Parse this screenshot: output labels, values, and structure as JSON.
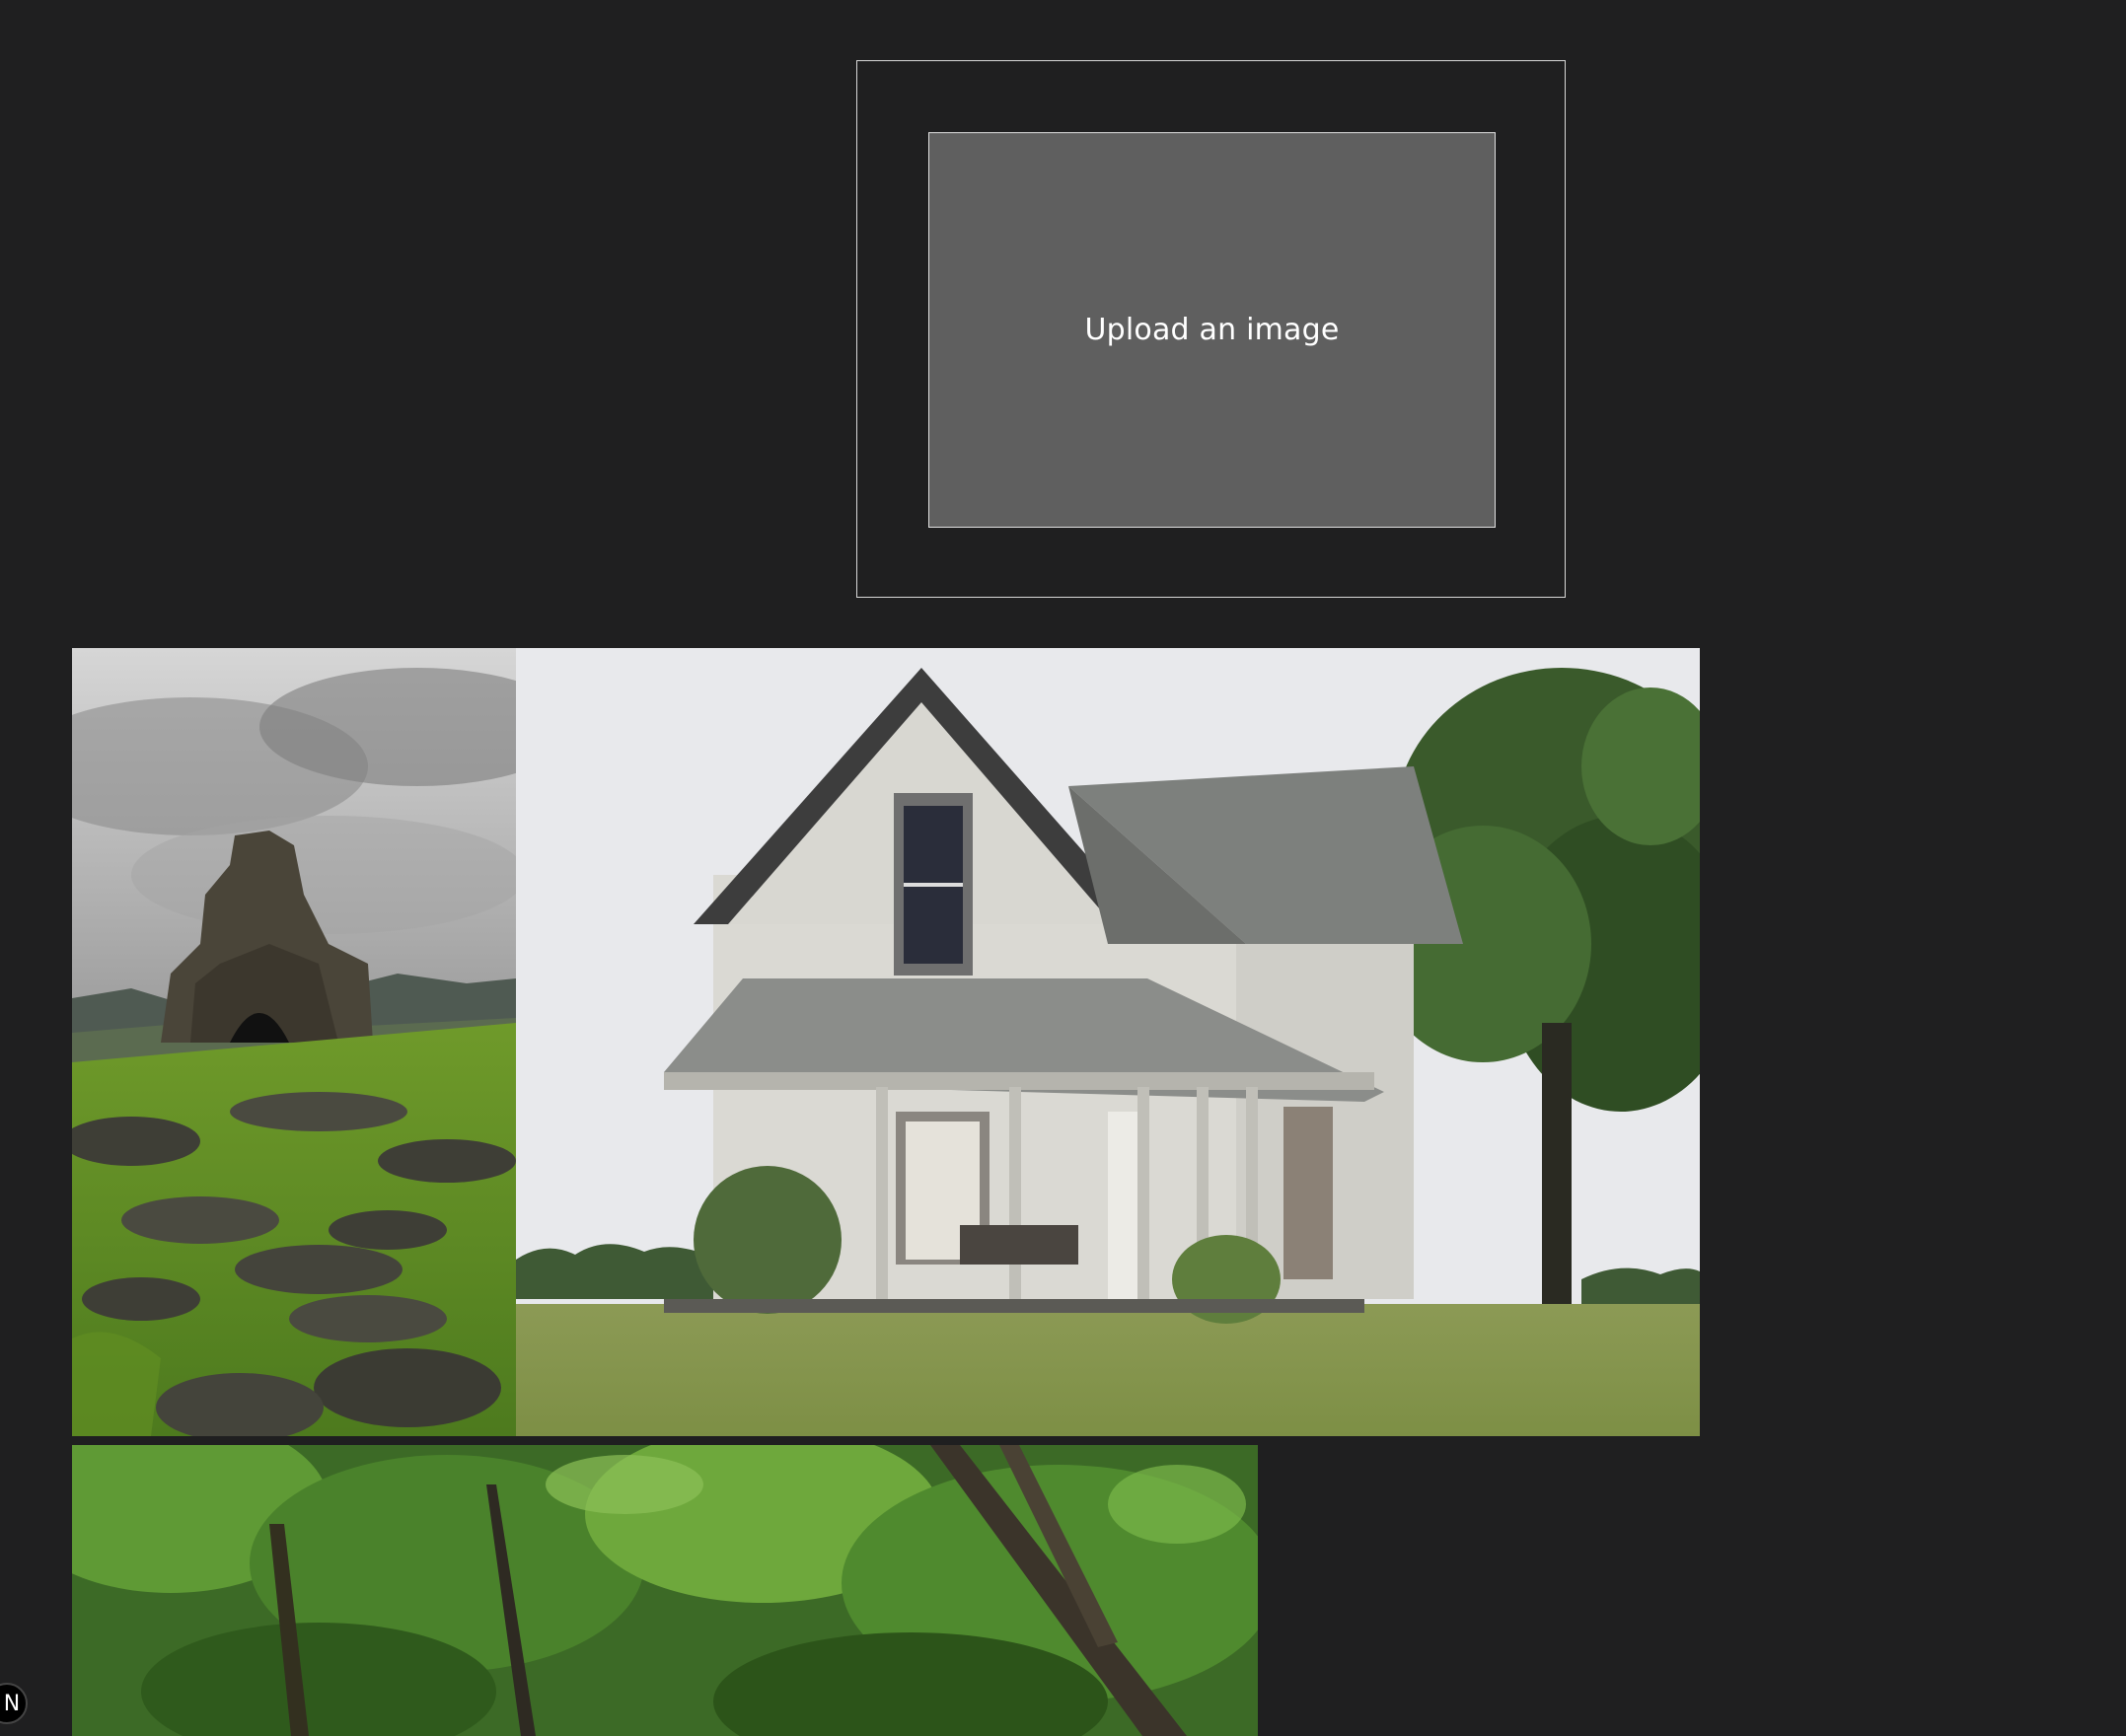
{
  "upload": {
    "label": "Upload an image"
  },
  "gallery": {
    "images": [
      {
        "subject": "temple ruins on mossy hill",
        "icon": "image-thumbnail-icon"
      },
      {
        "subject": "old white farmhouse with porch",
        "icon": "image-thumbnail-icon"
      },
      {
        "subject": "dense green forest canopy",
        "icon": "image-thumbnail-icon"
      }
    ]
  },
  "dev_badge": {
    "letter": "N"
  },
  "colors": {
    "background": "#1f1f20",
    "upload_fill": "#5f5f5f",
    "border": "#d8d8d8"
  }
}
